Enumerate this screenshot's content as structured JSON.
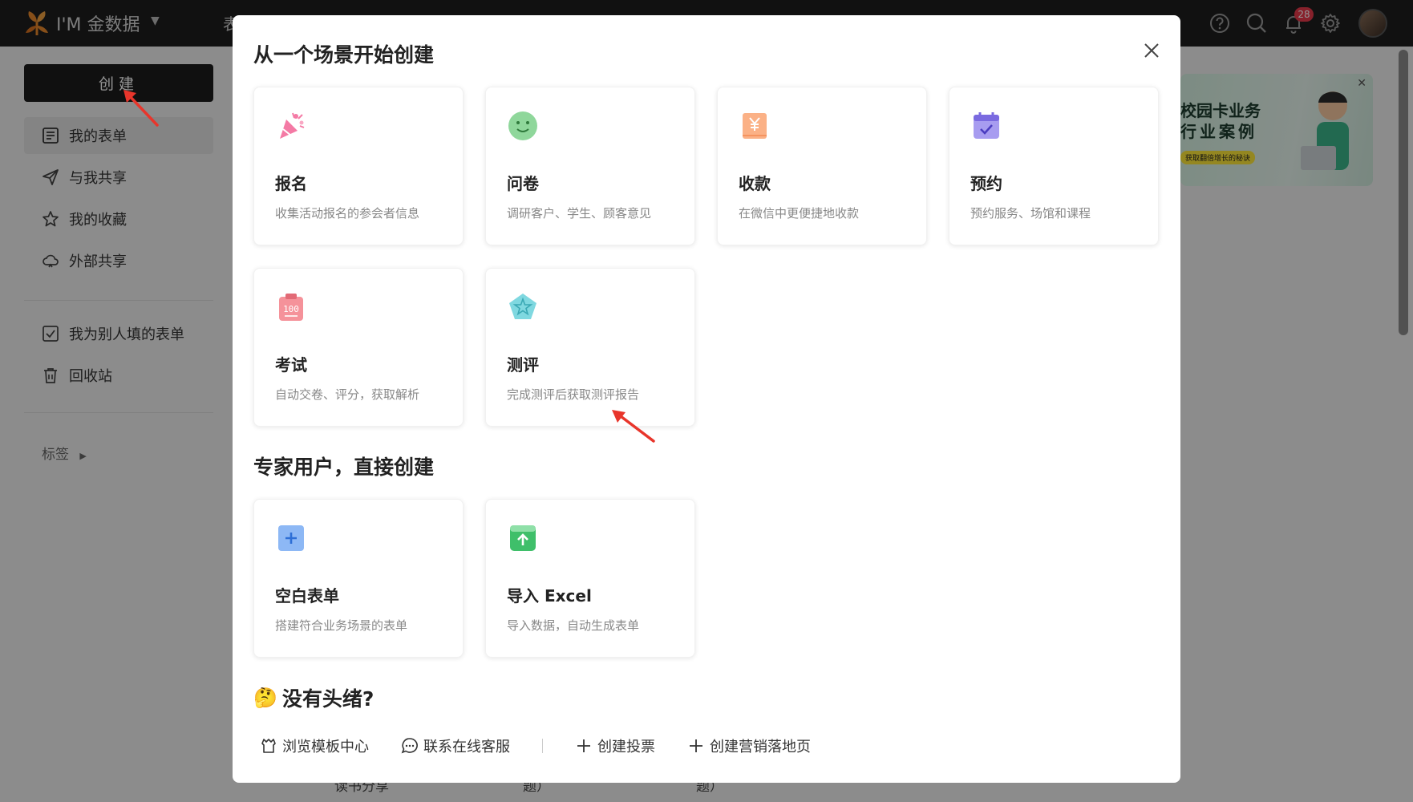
{
  "topbar": {
    "brand": "I'M 金数据",
    "nav_peek": "表",
    "notification_count": "28"
  },
  "sidebar": {
    "create_label": "创建",
    "items": [
      {
        "label": "我的表单",
        "icon": "form-list-icon"
      },
      {
        "label": "与我共享",
        "icon": "send-icon"
      },
      {
        "label": "我的收藏",
        "icon": "star-icon"
      },
      {
        "label": "外部共享",
        "icon": "cloud-share-icon"
      },
      {
        "label": "我为别人填的表单",
        "icon": "checkbox-icon"
      },
      {
        "label": "回收站",
        "icon": "trash-icon"
      }
    ],
    "tags_label": "标签"
  },
  "background_peek": [
    "读书分享",
    "题）",
    "题）"
  ],
  "banner": {
    "line1": "校园卡业务",
    "line2": "行业案例",
    "cta": "获取翻倍增长的秘诀"
  },
  "modal": {
    "title": "从一个场景开始创建",
    "scenes": [
      {
        "title": "报名",
        "desc": "收集活动报名的参会者信息",
        "icon": "party-popper-icon"
      },
      {
        "title": "问卷",
        "desc": "调研客户、学生、顾客意见",
        "icon": "smiley-icon"
      },
      {
        "title": "收款",
        "desc": "在微信中更便捷地收款",
        "icon": "yuan-receipt-icon"
      },
      {
        "title": "预约",
        "desc": "预约服务、场馆和课程",
        "icon": "calendar-check-icon"
      },
      {
        "title": "考试",
        "desc": "自动交卷、评分，获取解析",
        "icon": "exam-clipboard-icon"
      },
      {
        "title": "测评",
        "desc": "完成测评后获取测评报告",
        "icon": "pentagon-star-icon"
      }
    ],
    "expert_title": "专家用户，直接创建",
    "expert": [
      {
        "title": "空白表单",
        "desc": "搭建符合业务场景的表单",
        "icon": "blank-form-plus-icon"
      },
      {
        "title": "导入 Excel",
        "desc": "导入数据，自动生成表单",
        "icon": "excel-upload-icon"
      }
    ],
    "no_idea_emoji": "🤔",
    "no_idea_title": "没有头绪?",
    "links": [
      {
        "label": "浏览模板中心",
        "icon": "template-icon"
      },
      {
        "label": "联系在线客服",
        "icon": "chat-bubble-icon"
      },
      {
        "label": "创建投票",
        "icon": "plus-icon"
      },
      {
        "label": "创建营销落地页",
        "icon": "plus-icon"
      }
    ]
  },
  "colors": {
    "accent_dark": "#1c1c1c",
    "badge": "#e9394b",
    "annotation_arrow": "#e8352b"
  }
}
